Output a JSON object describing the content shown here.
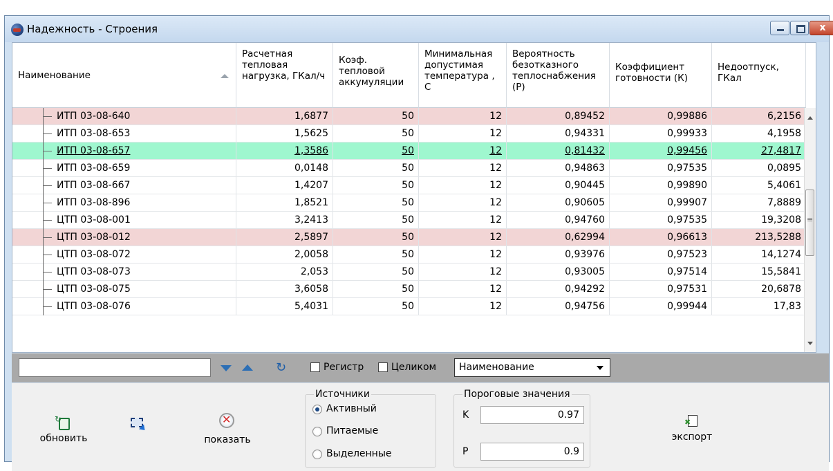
{
  "window": {
    "title": "Надежность - Строения",
    "close_label": "x"
  },
  "columns": [
    "Наименование",
    "Расчетная тепловая нагрузка, ГКал/ч",
    "Коэф. тепловой аккумуляции",
    "Минимальная допустимая температура , С",
    "Вероятность безотказного теплоснабжения (P)",
    "Коэффициент готовности (К)",
    "Недоотпуск, ГКал"
  ],
  "rows": [
    {
      "name": "ИТП 03-08-640",
      "load": "1,6877",
      "accum": "50",
      "temp": "12",
      "p": "0,89452",
      "k": "0,99886",
      "short": "6,2156",
      "highlight": "red"
    },
    {
      "name": "ИТП 03-08-653",
      "load": "1,5625",
      "accum": "50",
      "temp": "12",
      "p": "0,94331",
      "k": "0,99933",
      "short": "4,1958",
      "highlight": ""
    },
    {
      "name": "ИТП 03-08-657",
      "load": "1,3586",
      "accum": "50",
      "temp": "12",
      "p": "0,81432",
      "k": "0,99456",
      "short": "27,4817",
      "highlight": "green"
    },
    {
      "name": "ИТП 03-08-659",
      "load": "0,0148",
      "accum": "50",
      "temp": "12",
      "p": "0,94863",
      "k": "0,97535",
      "short": "0,0895",
      "highlight": ""
    },
    {
      "name": "ИТП 03-08-667",
      "load": "1,4207",
      "accum": "50",
      "temp": "12",
      "p": "0,90445",
      "k": "0,99890",
      "short": "5,4061",
      "highlight": ""
    },
    {
      "name": "ИТП 03-08-896",
      "load": "1,8521",
      "accum": "50",
      "temp": "12",
      "p": "0,90605",
      "k": "0,99907",
      "short": "7,8889",
      "highlight": ""
    },
    {
      "name": "ЦТП 03-08-001",
      "load": "3,2413",
      "accum": "50",
      "temp": "12",
      "p": "0,94760",
      "k": "0,97535",
      "short": "19,3208",
      "highlight": ""
    },
    {
      "name": "ЦТП 03-08-012",
      "load": "2,5897",
      "accum": "50",
      "temp": "12",
      "p": "0,62994",
      "k": "0,96613",
      "short": "213,5288",
      "highlight": "red"
    },
    {
      "name": "ЦТП 03-08-072",
      "load": "2,0058",
      "accum": "50",
      "temp": "12",
      "p": "0,93976",
      "k": "0,97523",
      "short": "14,1274",
      "highlight": ""
    },
    {
      "name": "ЦТП 03-08-073",
      "load": "2,053",
      "accum": "50",
      "temp": "12",
      "p": "0,93005",
      "k": "0,97514",
      "short": "15,5841",
      "highlight": ""
    },
    {
      "name": "ЦТП 03-08-075",
      "load": "3,6058",
      "accum": "50",
      "temp": "12",
      "p": "0,94292",
      "k": "0,97531",
      "short": "20,6878",
      "highlight": ""
    },
    {
      "name": "ЦТП 03-08-076",
      "load": "5,4031",
      "accum": "50",
      "temp": "12",
      "p": "0,94756",
      "k": "0,99944",
      "short": "17,83",
      "highlight": ""
    }
  ],
  "search": {
    "value": "",
    "register_label": "Регистр",
    "whole_label": "Целиком",
    "field_select": "Наименование"
  },
  "toolbar": {
    "refresh_label": "обновить",
    "show_label": "показать",
    "export_label": "экспорт"
  },
  "sources": {
    "title": "Источники",
    "options": [
      "Активный",
      "Питаемые",
      "Выделенные"
    ],
    "selected": "Активный"
  },
  "thresholds": {
    "title": "Пороговые значения",
    "k_label": "K",
    "k_value": "0.97",
    "p_label": "P",
    "p_value": "0.9"
  },
  "colors": {
    "row_red": "#f2d5d5",
    "row_green": "#9ff7cf",
    "search_bar": "#a9a9a9"
  }
}
